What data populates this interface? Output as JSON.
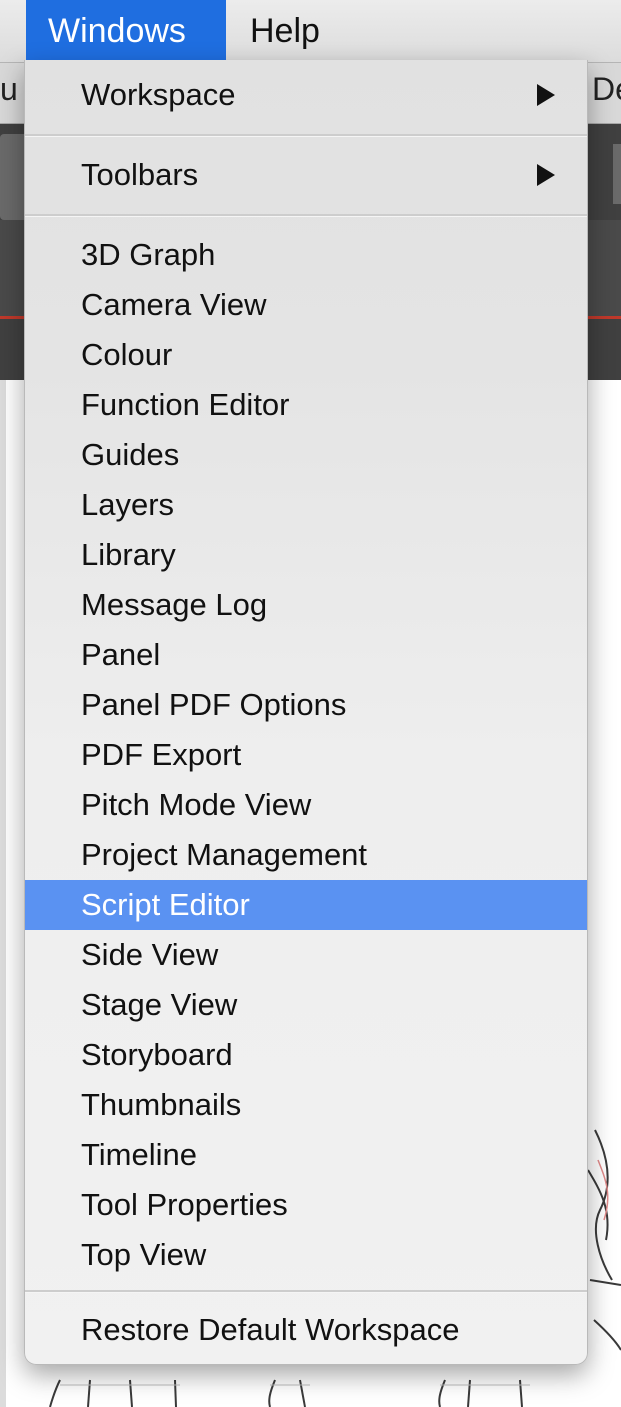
{
  "menubar": {
    "items": [
      {
        "label": "Windows",
        "active": true
      },
      {
        "label": "Help",
        "active": false
      }
    ]
  },
  "background": {
    "left_peek": "u",
    "right_peek": "De",
    "accent_color": "#1f6ee0",
    "dark_panel_color": "#404040",
    "timeline_line_color": "#c0392b"
  },
  "menu": {
    "workspace": {
      "label": "Workspace",
      "has_submenu": true
    },
    "toolbars": {
      "label": "Toolbars",
      "has_submenu": true
    },
    "items": [
      {
        "label": "3D Graph"
      },
      {
        "label": "Camera View"
      },
      {
        "label": "Colour"
      },
      {
        "label": "Function Editor"
      },
      {
        "label": "Guides"
      },
      {
        "label": "Layers"
      },
      {
        "label": "Library"
      },
      {
        "label": "Message Log"
      },
      {
        "label": "Panel"
      },
      {
        "label": "Panel PDF Options"
      },
      {
        "label": "PDF Export"
      },
      {
        "label": "Pitch Mode View"
      },
      {
        "label": "Project Management"
      },
      {
        "label": "Script Editor",
        "highlighted": true
      },
      {
        "label": "Side View"
      },
      {
        "label": "Stage View"
      },
      {
        "label": "Storyboard"
      },
      {
        "label": "Thumbnails"
      },
      {
        "label": "Timeline"
      },
      {
        "label": "Tool Properties"
      },
      {
        "label": "Top View"
      }
    ],
    "restore": {
      "label": "Restore Default Workspace"
    },
    "highlight_color": "#5a92f2"
  }
}
